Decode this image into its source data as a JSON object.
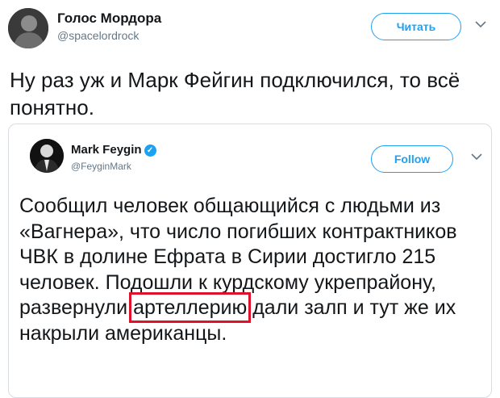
{
  "outer_tweet": {
    "author_name": "Голос Мордора",
    "handle": "@spacelordrock",
    "follow_label": "Читать",
    "text": "Ну раз уж и Марк Фейгин подключился, то всё понятно."
  },
  "quoted_tweet": {
    "author_name": "Mark Feygin",
    "verified_badge": "✓",
    "handle": "@FeyginMark",
    "follow_label": "Follow",
    "text_before": "Сообщил человек общающийся с людьми из «Вагнера», что число погибших контрактников ЧВК в долине Ефрата в Сирии достигло 215 человек. Подошли к курдскому укрепрайону, развернули ",
    "highlighted_word": "артеллерию",
    "text_after": " дали залп и тут же их накрыли американцы."
  },
  "colors": {
    "accent": "#1da1f2",
    "highlight_box": "#e0112b",
    "text": "#14171a",
    "secondary": "#657786"
  },
  "icons": {
    "menu": "chevron-down-icon",
    "verified": "verified-badge-icon"
  }
}
